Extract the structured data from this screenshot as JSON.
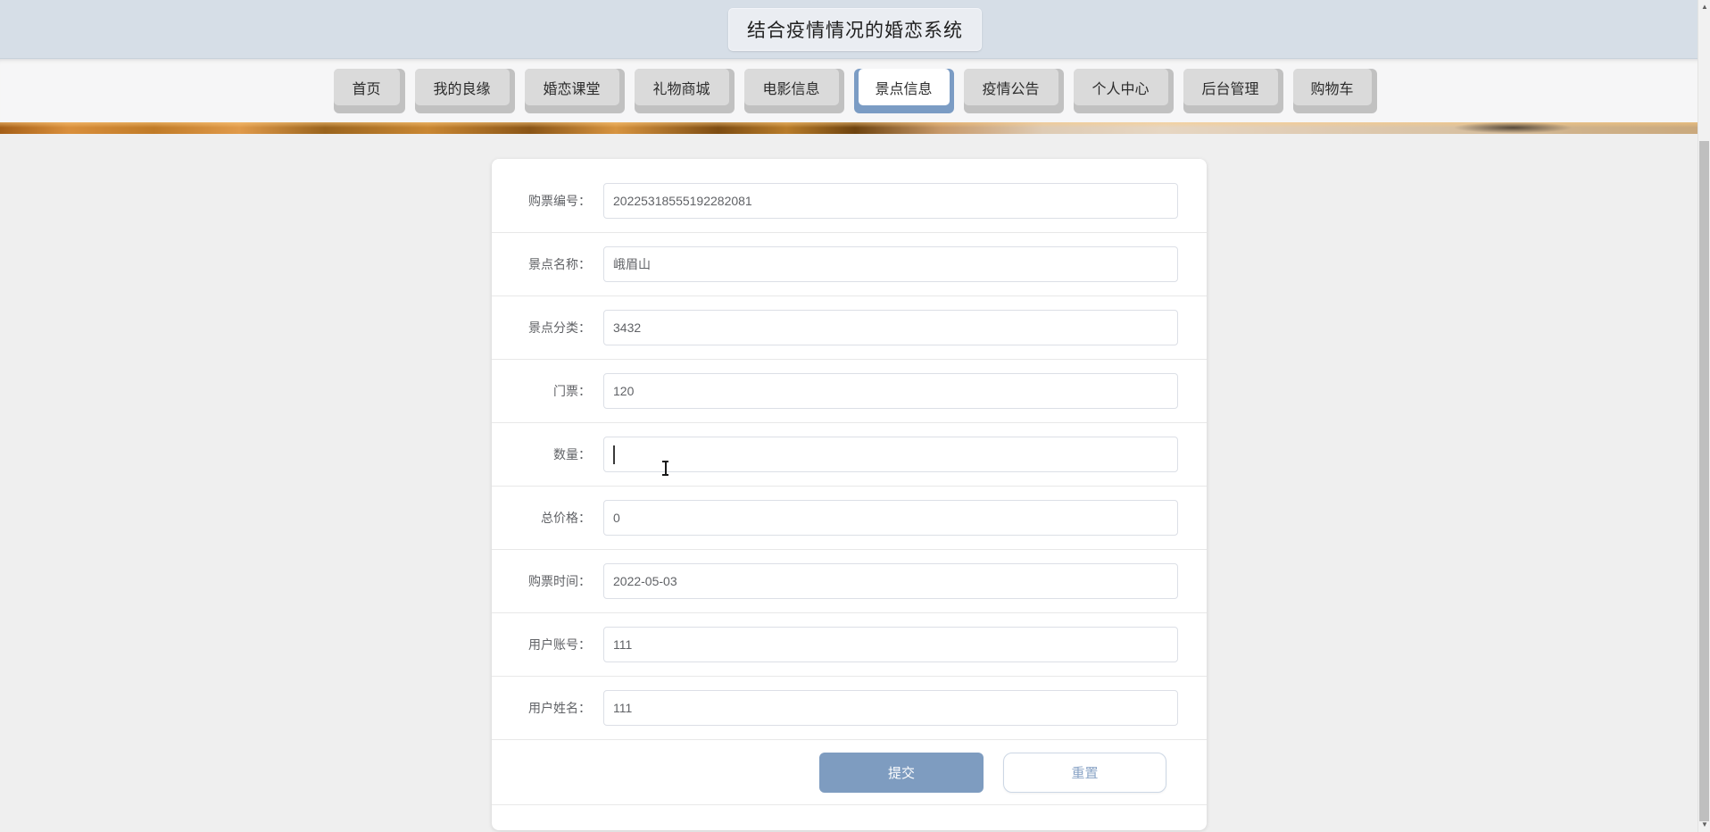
{
  "header": {
    "title": "结合疫情情况的婚恋系统"
  },
  "nav": {
    "tabs": [
      {
        "label": "首页",
        "active": false
      },
      {
        "label": "我的良缘",
        "active": false
      },
      {
        "label": "婚恋课堂",
        "active": false
      },
      {
        "label": "礼物商城",
        "active": false
      },
      {
        "label": "电影信息",
        "active": false
      },
      {
        "label": "景点信息",
        "active": true
      },
      {
        "label": "疫情公告",
        "active": false
      },
      {
        "label": "个人中心",
        "active": false
      },
      {
        "label": "后台管理",
        "active": false
      },
      {
        "label": "购物车",
        "active": false
      }
    ]
  },
  "form": {
    "rows": [
      {
        "label": "购票编号：",
        "value": "20225318555192282081"
      },
      {
        "label": "景点名称：",
        "value": "峨眉山"
      },
      {
        "label": "景点分类：",
        "value": "3432"
      },
      {
        "label": "门票：",
        "value": "120"
      },
      {
        "label": "数量：",
        "value": ""
      },
      {
        "label": "总价格：",
        "value": "0"
      },
      {
        "label": "购票时间：",
        "value": "2022-05-03"
      },
      {
        "label": "用户账号：",
        "value": "111"
      },
      {
        "label": "用户姓名：",
        "value": "111"
      }
    ],
    "submit_label": "提交",
    "reset_label": "重置"
  },
  "colors": {
    "header_bg": "#d6dee7",
    "title_box_bg": "#eaedf2",
    "nav_bg": "#f6f6f7",
    "tab_face": "#dadada",
    "tab_shadow": "#c1c1c1",
    "active_tab_face": "#ffffff",
    "active_tab_shadow": "#7b9cc4",
    "page_bg": "#efefef",
    "card_bg": "#ffffff",
    "divider": "#e8e8e8",
    "input_border": "#dcdfe6",
    "label_text": "#606266",
    "submit_bg": "#7e9cc0",
    "reset_border": "#ccd7e5",
    "reset_text": "#8aa4c6",
    "banner_orange": "#c98733"
  }
}
